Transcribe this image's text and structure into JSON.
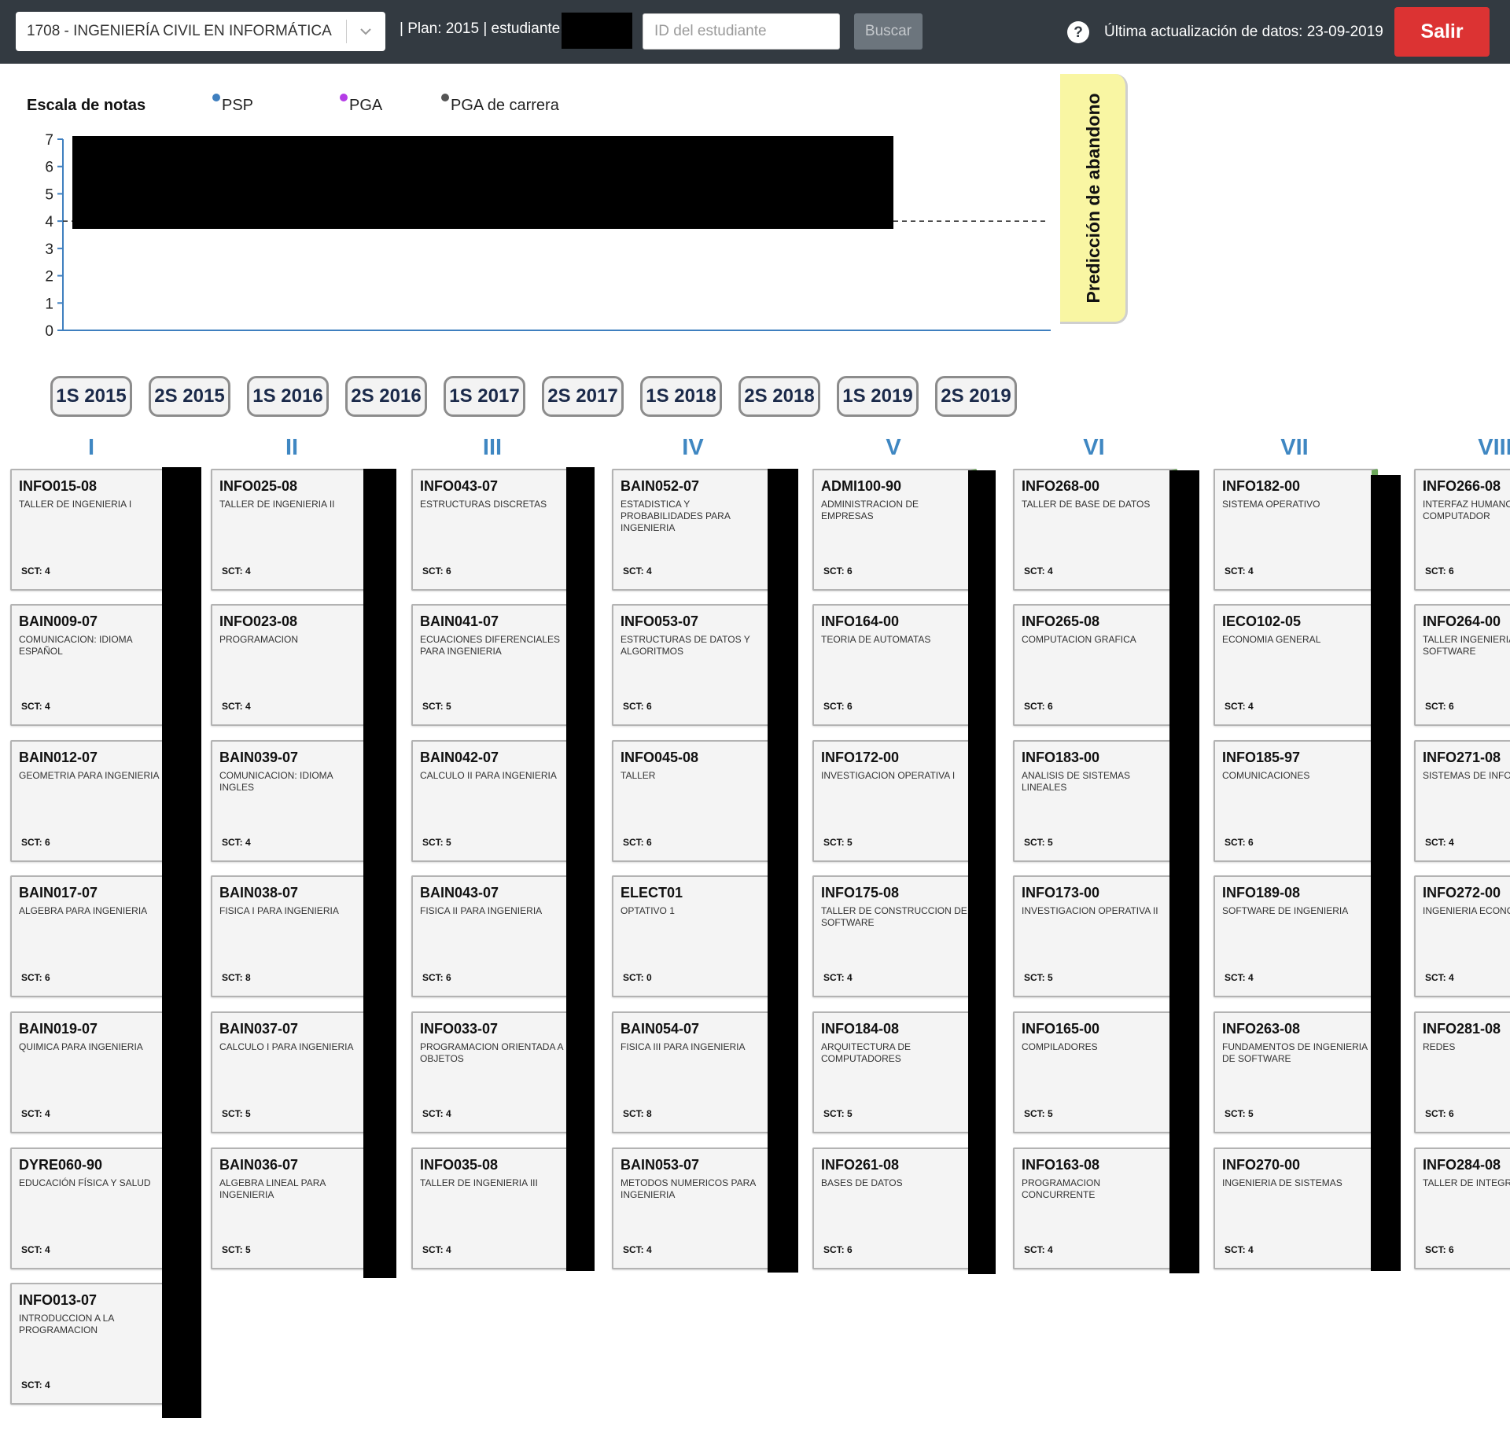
{
  "header": {
    "program": "1708 - INGENIERÍA CIVIL EN INFORMÁTICA",
    "plan_text": "| Plan: 2015 | estudiante:",
    "student_id_placeholder": "ID del estudiante",
    "search_label": "Buscar",
    "last_update": "Última actualización de datos: 23-09-2019",
    "logout_label": "Salir"
  },
  "chart": {
    "title": "Escala de notas",
    "legend": [
      {
        "label": "PSP",
        "color": "#3f7fbf"
      },
      {
        "label": "PGA",
        "color": "#b43ce6"
      },
      {
        "label": "PGA de carrera",
        "color": "#555555"
      }
    ],
    "dropout_label": "Predicción de abandono"
  },
  "chart_data": {
    "type": "line",
    "title": "",
    "ylim": [
      0,
      7
    ],
    "yticks": [
      "0",
      "1",
      "2",
      "3",
      "4",
      "5",
      "6",
      "7"
    ],
    "reference_line": 4
  },
  "semesters": [
    "1S 2015",
    "2S 2015",
    "1S 2016",
    "2S 2016",
    "1S 2017",
    "2S 2017",
    "1S 2018",
    "2S 2018",
    "1S 2019",
    "2S 2019"
  ],
  "levels": [
    {
      "label": "I",
      "courses": [
        {
          "code": "INFO015-08",
          "name": "TALLER DE INGENIERIA I",
          "sct": "SCT: 4"
        },
        {
          "code": "BAIN009-07",
          "name": "COMUNICACION: IDIOMA ESPAÑOL",
          "sct": "SCT: 4"
        },
        {
          "code": "BAIN012-07",
          "name": "GEOMETRIA PARA INGENIERIA",
          "sct": "SCT: 6"
        },
        {
          "code": "BAIN017-07",
          "name": "ALGEBRA PARA INGENIERIA",
          "sct": "SCT: 6"
        },
        {
          "code": "BAIN019-07",
          "name": "QUIMICA PARA INGENIERIA",
          "sct": "SCT: 4"
        },
        {
          "code": "DYRE060-90",
          "name": "EDUCACIÓN FÍSICA Y SALUD",
          "sct": "SCT: 4"
        },
        {
          "code": "INFO013-07",
          "name": "INTRODUCCION A LA PROGRAMACION",
          "sct": "SCT: 4"
        }
      ]
    },
    {
      "label": "II",
      "courses": [
        {
          "code": "INFO025-08",
          "name": "TALLER DE INGENIERIA II",
          "sct": "SCT: 4"
        },
        {
          "code": "INFO023-08",
          "name": "PROGRAMACION",
          "sct": "SCT: 4"
        },
        {
          "code": "BAIN039-07",
          "name": "COMUNICACION: IDIOMA INGLES",
          "sct": "SCT: 4"
        },
        {
          "code": "BAIN038-07",
          "name": "FISICA I PARA INGENIERIA",
          "sct": "SCT: 8"
        },
        {
          "code": "BAIN037-07",
          "name": "CALCULO I PARA INGENIERIA",
          "sct": "SCT: 5"
        },
        {
          "code": "BAIN036-07",
          "name": "ALGEBRA LINEAL PARA INGENIERIA",
          "sct": "SCT: 5"
        }
      ]
    },
    {
      "label": "III",
      "courses": [
        {
          "code": "INFO043-07",
          "name": "ESTRUCTURAS DISCRETAS",
          "sct": "SCT: 6"
        },
        {
          "code": "BAIN041-07",
          "name": "ECUACIONES DIFERENCIALES PARA INGENIERIA",
          "sct": "SCT: 5"
        },
        {
          "code": "BAIN042-07",
          "name": "CALCULO II PARA INGENIERIA",
          "sct": "SCT: 5"
        },
        {
          "code": "BAIN043-07",
          "name": "FISICA II PARA INGENIERIA",
          "sct": "SCT: 6"
        },
        {
          "code": "INFO033-07",
          "name": "PROGRAMACION ORIENTADA A OBJETOS",
          "sct": "SCT: 4"
        },
        {
          "code": "INFO035-08",
          "name": "TALLER DE INGENIERIA III",
          "sct": "SCT: 4"
        }
      ]
    },
    {
      "label": "IV",
      "courses": [
        {
          "code": "BAIN052-07",
          "name": "ESTADISTICA Y PROBABILIDADES PARA INGENIERIA",
          "sct": "SCT: 4"
        },
        {
          "code": "INFO053-07",
          "name": "ESTRUCTURAS DE DATOS Y ALGORITMOS",
          "sct": "SCT: 6"
        },
        {
          "code": "INFO045-08",
          "name": "TALLER",
          "sct": "SCT: 6"
        },
        {
          "code": "ELECT01",
          "name": "OPTATIVO 1",
          "sct": "SCT: 0"
        },
        {
          "code": "BAIN054-07",
          "name": "FISICA III PARA INGENIERIA",
          "sct": "SCT: 8"
        },
        {
          "code": "BAIN053-07",
          "name": "METODOS NUMERICOS PARA INGENIERIA",
          "sct": "SCT: 4"
        }
      ]
    },
    {
      "label": "V",
      "courses": [
        {
          "code": "ADMI100-90",
          "name": "ADMINISTRACION DE EMPRESAS",
          "sct": "SCT: 6"
        },
        {
          "code": "INFO164-00",
          "name": "TEORIA DE AUTOMATAS",
          "sct": "SCT: 6"
        },
        {
          "code": "INFO172-00",
          "name": "INVESTIGACION OPERATIVA I",
          "sct": "SCT: 5"
        },
        {
          "code": "INFO175-08",
          "name": "TALLER DE CONSTRUCCION DE SOFTWARE",
          "sct": "SCT: 4"
        },
        {
          "code": "INFO184-08",
          "name": "ARQUITECTURA DE COMPUTADORES",
          "sct": "SCT: 5"
        },
        {
          "code": "INFO261-08",
          "name": "BASES DE DATOS",
          "sct": "SCT: 6"
        }
      ]
    },
    {
      "label": "VI",
      "courses": [
        {
          "code": "INFO268-00",
          "name": "TALLER DE BASE DE DATOS",
          "sct": "SCT: 4"
        },
        {
          "code": "INFO265-08",
          "name": "COMPUTACION GRAFICA",
          "sct": "SCT: 6"
        },
        {
          "code": "INFO183-00",
          "name": "ANALISIS DE SISTEMAS LINEALES",
          "sct": "SCT: 5"
        },
        {
          "code": "INFO173-00",
          "name": "INVESTIGACION OPERATIVA II",
          "sct": "SCT: 5"
        },
        {
          "code": "INFO165-00",
          "name": "COMPILADORES",
          "sct": "SCT: 5"
        },
        {
          "code": "INFO163-08",
          "name": "PROGRAMACION CONCURRENTE",
          "sct": "SCT: 4"
        }
      ]
    },
    {
      "label": "VII",
      "courses": [
        {
          "code": "INFO182-00",
          "name": "SISTEMA OPERATIVO",
          "sct": "SCT: 4"
        },
        {
          "code": "IECO102-05",
          "name": "ECONOMIA GENERAL",
          "sct": "SCT: 4"
        },
        {
          "code": "INFO185-97",
          "name": "COMUNICACIONES",
          "sct": "SCT: 6"
        },
        {
          "code": "INFO189-08",
          "name": "SOFTWARE DE INGENIERIA",
          "sct": "SCT: 4"
        },
        {
          "code": "INFO263-08",
          "name": "FUNDAMENTOS DE INGENIERIA DE SOFTWARE",
          "sct": "SCT: 5"
        },
        {
          "code": "INFO270-00",
          "name": "INGENIERIA DE SISTEMAS",
          "sct": "SCT: 4"
        }
      ]
    },
    {
      "label": "VIII",
      "courses": [
        {
          "code": "INFO266-08",
          "name": "INTERFAZ HUMANO COMPUTADOR",
          "sct": "SCT: 6"
        },
        {
          "code": "INFO264-00",
          "name": "TALLER INGENIERIA DE SOFTWARE",
          "sct": "SCT: 6"
        },
        {
          "code": "INFO271-08",
          "name": "SISTEMAS DE INFORMACION",
          "sct": "SCT: 4"
        },
        {
          "code": "INFO272-00",
          "name": "INGENIERIA ECONOMICA",
          "sct": "SCT: 4"
        },
        {
          "code": "INFO281-08",
          "name": "REDES",
          "sct": "SCT: 6"
        },
        {
          "code": "INFO284-08",
          "name": "TALLER DE INTEGRACION TIC",
          "sct": "SCT: 6"
        }
      ]
    }
  ]
}
